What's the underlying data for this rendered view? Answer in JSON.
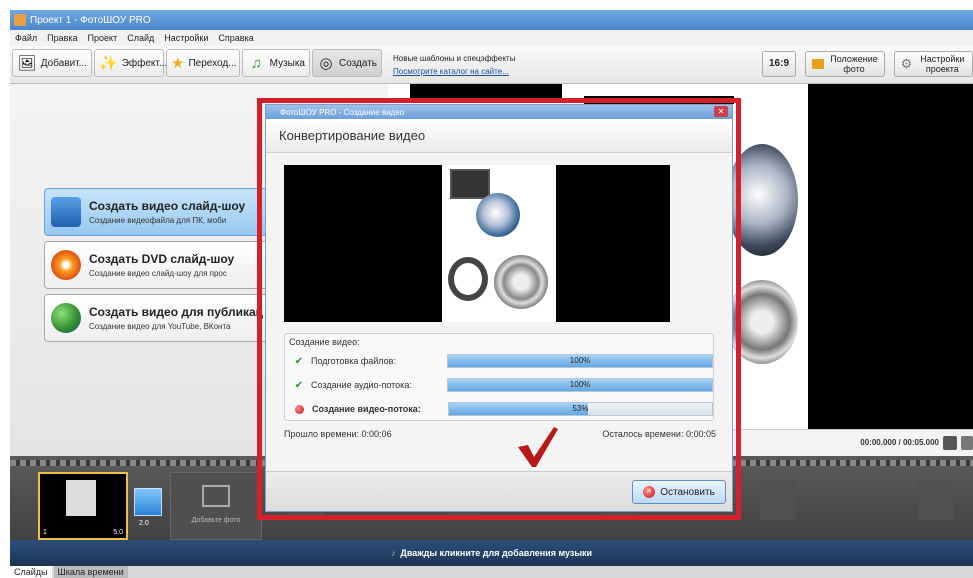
{
  "window": {
    "title": "Проект 1 - ФотоШОУ PRO"
  },
  "menu": [
    "Файл",
    "Правка",
    "Проект",
    "Слайд",
    "Настройки",
    "Справка"
  ],
  "tabs": [
    {
      "label": "Добавит...",
      "icon": "photo-album-icon"
    },
    {
      "label": "Эффект...",
      "icon": "effects-icon"
    },
    {
      "label": "Переход...",
      "icon": "star-icon"
    },
    {
      "label": "Музыка",
      "icon": "music-note-icon"
    },
    {
      "label": "Создать",
      "icon": "disc-icon"
    }
  ],
  "news": {
    "line1": "Новые шаблоны и спецэффекты",
    "line2": "Посмотрите каталог на сайте..."
  },
  "toolbar_right": {
    "ratio": "16:9",
    "position_photo": "Положение фото",
    "project_settings": "Настройки проекта"
  },
  "options": [
    {
      "title": "Создать видео слайд-шоу",
      "desc": "Создание видеофайла для ПК, моби"
    },
    {
      "title": "Создать DVD слайд-шоу",
      "desc": "Создание видео слайд-шоу для прос"
    },
    {
      "title": "Создать видео для публикац",
      "desc": "Создание видео для YouTube, ВКонта"
    }
  ],
  "preview": {
    "timecode": "00:00.000 / 00:05.000"
  },
  "timeline": {
    "slide_number": "1",
    "slide_duration": "5.0",
    "transition_duration": "2.0",
    "add_photo": "Добавьте фото",
    "music_hint": "Дважды кликните для добавления музыки"
  },
  "bottom_tabs": [
    "Слайды",
    "Шкала времени"
  ],
  "dialog": {
    "title": "ФотоШОУ PRO - Создание видео",
    "header": "Конвертирование видео",
    "progress_title": "Создание видео:",
    "steps": [
      {
        "label": "Подготовка файлов:",
        "percent": 100,
        "percent_text": "100%",
        "status": "done"
      },
      {
        "label": "Создание аудио-потока:",
        "percent": 100,
        "percent_text": "100%",
        "status": "done"
      },
      {
        "label": "Создание видео-потока:",
        "percent": 53,
        "percent_text": "53%",
        "status": "active"
      }
    ],
    "elapsed": "Прошло времени: 0:00:06",
    "remaining": "Осталось времени: 0:00:05",
    "stop_button": "Остановить"
  },
  "colors": {
    "highlight": "#d42028",
    "accent": "#4a86cc",
    "progress_fill": "#62a6e4"
  }
}
